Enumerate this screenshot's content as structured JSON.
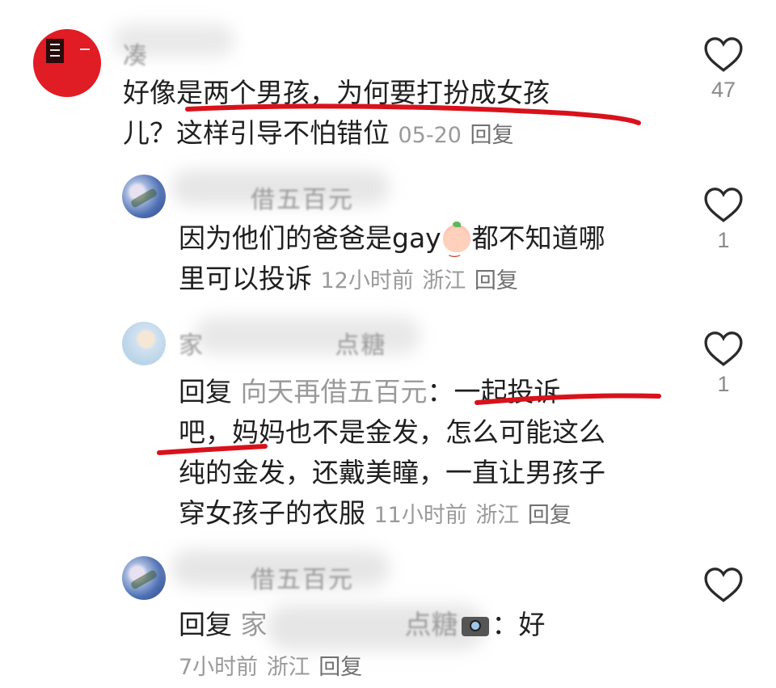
{
  "comments": [
    {
      "line1": "好像是两个男孩，为何要打扮成女孩",
      "line2": "儿？这样引导不怕错位",
      "date": "05-20",
      "reply_label": "回复",
      "likes": "47",
      "name_partial": "凑"
    },
    {
      "name_partial": "借五百元",
      "line1_a": "因为他们的爸爸是gay",
      "emoji": "peach-face-emoji",
      "line1_b": "都不知道哪",
      "line2": "里可以投诉",
      "time": "12小时前",
      "location": "浙江",
      "reply_label": "回复",
      "likes": "1"
    },
    {
      "name_partial_start": "家",
      "name_partial_end": "点糖",
      "reply_prefix": "回复",
      "reply_to": "向天再借五百元",
      "line1": "：一起投诉",
      "line2": "吧，妈妈也不是金发，怎么可能这么",
      "line3": "纯的金发，还戴美瞳，一直让男孩子",
      "line4": "穿女孩子的衣服",
      "time": "11小时前",
      "location": "浙江",
      "reply_label": "回复",
      "likes": "1"
    },
    {
      "name_partial": "借五百元",
      "reply_prefix": "回复",
      "reply_to_partial_start": "家",
      "reply_to_partial_end": "点糖",
      "suffix": "：好",
      "time": "7小时前",
      "location": "浙江",
      "reply_label": "回复"
    }
  ]
}
